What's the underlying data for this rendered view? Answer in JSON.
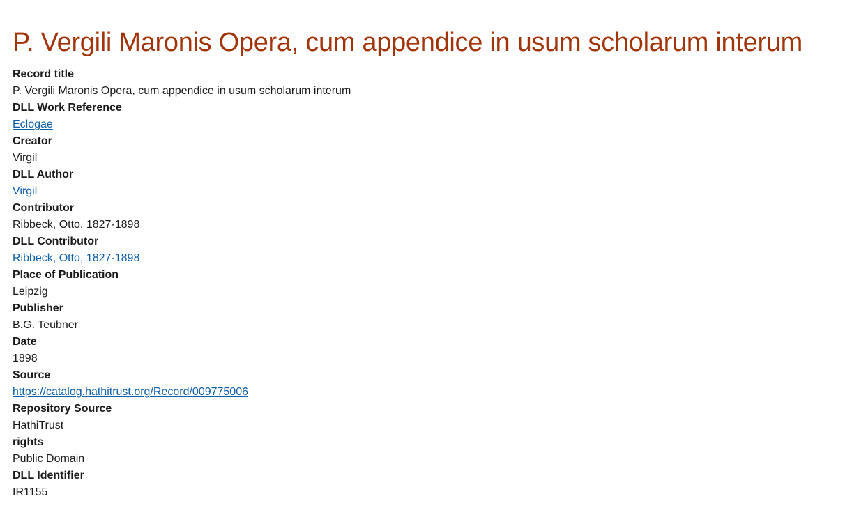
{
  "record": {
    "title": "P. Vergili Maronis Opera, cum appendice in usum scholarum interum",
    "fields": [
      {
        "label": "Record title",
        "value": "P. Vergili Maronis Opera, cum appendice in usum scholarum interum",
        "link": false
      },
      {
        "label": "DLL Work Reference",
        "value": "Eclogae",
        "link": true
      },
      {
        "label": "Creator",
        "value": "Virgil",
        "link": false
      },
      {
        "label": "DLL Author",
        "value": "Virgil",
        "link": true
      },
      {
        "label": "Contributor",
        "value": "Ribbeck, Otto, 1827-1898",
        "link": false
      },
      {
        "label": "DLL Contributor",
        "value": "Ribbeck, Otto, 1827-1898",
        "link": true
      },
      {
        "label": "Place of Publication",
        "value": "Leipzig",
        "link": false
      },
      {
        "label": "Publisher",
        "value": "B.G. Teubner",
        "link": false
      },
      {
        "label": "Date",
        "value": "1898",
        "link": false
      },
      {
        "label": "Source",
        "value": "https://catalog.hathitrust.org/Record/009775006",
        "link": true
      },
      {
        "label": "Repository Source",
        "value": "HathiTrust",
        "link": false
      },
      {
        "label": "rights",
        "value": "Public Domain",
        "link": false
      },
      {
        "label": "DLL Identifier",
        "value": "IR1155",
        "link": false
      }
    ]
  },
  "colors": {
    "title": "#a33409",
    "link": "#0b5ea8",
    "text": "#1a1a1a"
  }
}
